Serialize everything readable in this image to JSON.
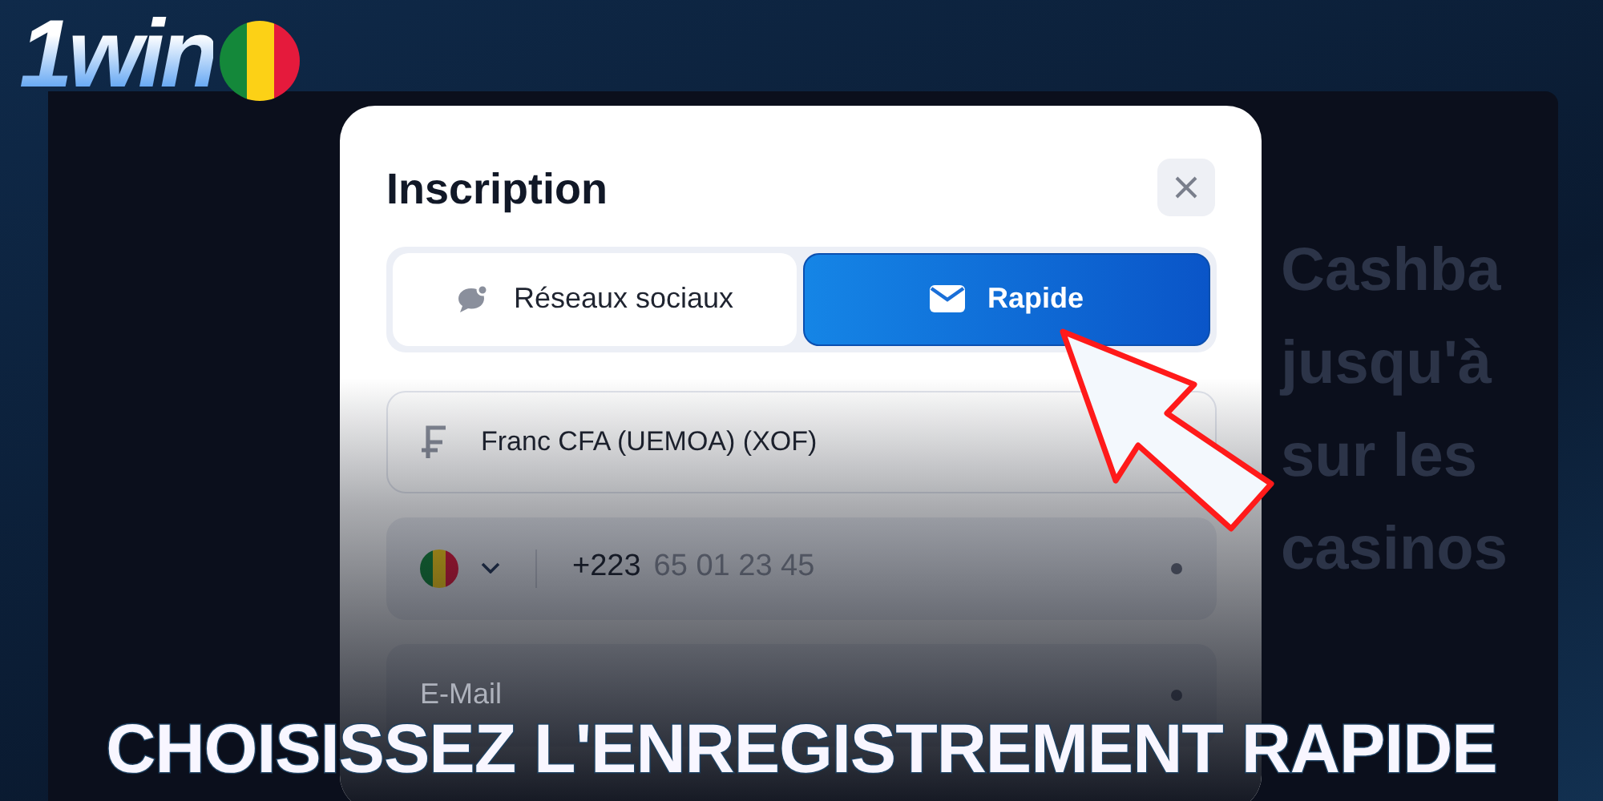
{
  "logo": {
    "text": "1win"
  },
  "promo_background": {
    "lines": [
      "Cashba",
      "jusqu'à",
      "sur les",
      "casinos"
    ]
  },
  "modal": {
    "title": "Inscription",
    "tabs": [
      {
        "label": "Réseaux sociaux",
        "kind": "social",
        "selected": false
      },
      {
        "label": "Rapide",
        "kind": "mail",
        "selected": true
      }
    ],
    "fields": [
      {
        "kind": "currency",
        "value": "Franc CFA (UEMOA) (XOF)"
      },
      {
        "kind": "phone",
        "code": "+223",
        "placeholder": "65 01 23 45"
      },
      {
        "kind": "email",
        "placeholder": "E-Mail"
      }
    ]
  },
  "caption": "CHOISISSEZ L'ENREGISTREMENT RAPIDE"
}
